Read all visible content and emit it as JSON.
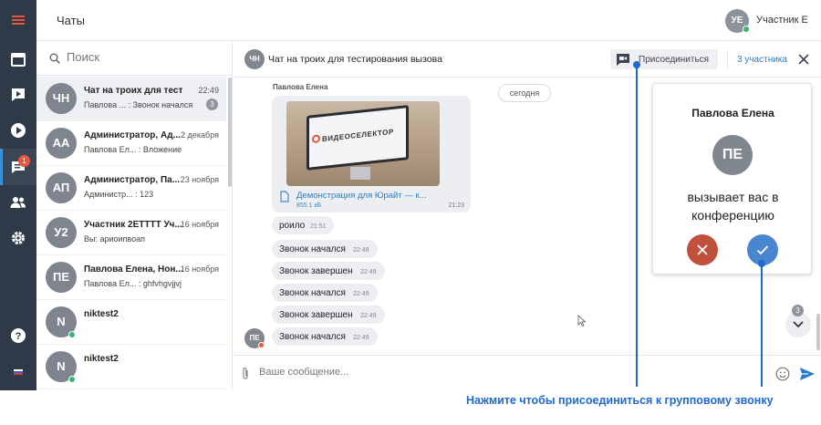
{
  "header": {
    "title": "Чаты",
    "user_initials": "УЕ",
    "user_name": "Участник Е"
  },
  "rail": {
    "items": [
      "menu-icon",
      "calendar-icon",
      "video-chat-icon",
      "play-icon",
      "chats-icon",
      "contacts-icon",
      "settings-icon",
      "help-icon",
      "language-flag-icon"
    ],
    "chat_badge": "1"
  },
  "search": {
    "placeholder": "Поиск"
  },
  "chats": [
    {
      "initials": "ЧН",
      "title": "Чат на троих для тестир...",
      "time": "22:49",
      "subtitle": "Павлова ... : Звонок начался",
      "unread": "3"
    },
    {
      "initials": "АА",
      "title": "Администратор, Ад...",
      "time": "2 декабря",
      "subtitle": "Павлова Ел... : Вложение"
    },
    {
      "initials": "АП",
      "title": "Администратор, Па...",
      "time": "23 ноября",
      "subtitle": "Администр... : 123"
    },
    {
      "initials": "У2",
      "title": "Участник 2ЕТТТТ Уч...",
      "time": "16 ноября",
      "subtitle": "Вы: ариоипвоап"
    },
    {
      "initials": "ПЕ",
      "title": "Павлова Елена, Нон...",
      "time": "16 ноября",
      "subtitle": "Павлова Ел... : ghfvhgvjjvj"
    },
    {
      "initials": "N",
      "title": "niktest2",
      "time": "",
      "subtitle": ""
    },
    {
      "initials": "N",
      "title": "niktest2",
      "time": "",
      "subtitle": ""
    }
  ],
  "conversation": {
    "initials": "ЧН",
    "title": "Чат на троих для тестирования вызова",
    "join_label": "Присоединиться",
    "participants": "3 участника",
    "sender": "Павлова Елена",
    "date_chip": "сегодня",
    "attachment": {
      "logo_text": "ВИДЕОСЕЛЕКТОР",
      "name": "Демонстрация для Юрайт — к...",
      "size": "855.1 кБ",
      "time": "21:23"
    },
    "messages": [
      {
        "text": "роило",
        "time": "21:51"
      },
      {
        "text": "Звонок начался",
        "time": "22:48"
      },
      {
        "text": "Звонок завершен",
        "time": "22:49"
      },
      {
        "text": "Звонок начался",
        "time": "22:49"
      },
      {
        "text": "Звонок завершен",
        "time": "22:49"
      },
      {
        "text": "Звонок начался",
        "time": "22:49"
      }
    ],
    "sender_initials": "ПЕ",
    "scroll_count": "3"
  },
  "composer": {
    "placeholder": "Ваше сообщение..."
  },
  "call_card": {
    "caller": "Павлова Елена",
    "initials": "ПЕ",
    "text": "вызывает вас в конференцию"
  },
  "annotation": {
    "text": "Нажмите чтобы присоединиться к групповому звонку"
  },
  "colors": {
    "rail": "#2f3a49",
    "accent": "#2a7cc7",
    "decline": "#c0513c",
    "accept": "#4a86cf",
    "annotation": "#1f6ad1"
  }
}
